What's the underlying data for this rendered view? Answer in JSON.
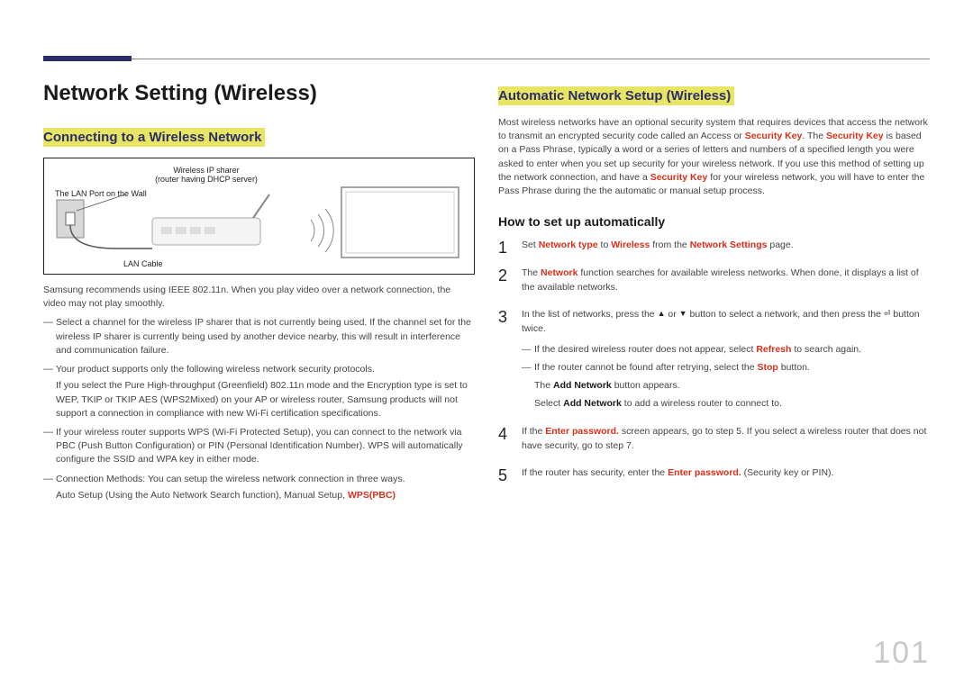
{
  "page_number": "101",
  "left": {
    "title": "Network Setting (Wireless)",
    "section1_head": "Connecting to a Wireless Network",
    "diagram": {
      "ip_sharer_l1": "Wireless IP sharer",
      "ip_sharer_l2": "(router having DHCP server)",
      "lan_port": "The LAN Port on the Wall",
      "lan_cable": "LAN Cable"
    },
    "intro": "Samsung recommends using IEEE 802.11n. When you play video over a network connection, the video may not play smoothly.",
    "bullets": [
      {
        "main": "Select a channel for the wireless IP sharer that is not currently being used. If the channel set for the wireless IP sharer is currently being used by another device nearby, this will result in interference and communication failure."
      },
      {
        "main": "Your product supports only the following wireless network security protocols.",
        "sub": "If you select the Pure High-throughput (Greenfield) 802.11n mode and the Encryption type is set to WEP, TKIP or TKIP AES (WPS2Mixed) on your AP or wireless router, Samsung products will not support a connection in compliance with new Wi-Fi certification specifications."
      },
      {
        "main": "If your wireless router supports WPS (Wi-Fi Protected Setup), you can connect to the network via PBC (Push Button Configuration) or PIN (Personal Identification Number). WPS will automatically configure the SSID and WPA key in either mode."
      },
      {
        "main": "Connection Methods: You can setup the wireless network connection in three ways.",
        "sub_pre": "Auto Setup (Using the Auto Network Search function), Manual Setup, ",
        "sub_hl": "WPS(PBC)"
      }
    ]
  },
  "right": {
    "section2_head": "Automatic Network Setup (Wireless)",
    "para_parts": {
      "p1": "Most wireless networks have an optional security system that requires devices that access the network to transmit an encrypted security code called an Access or ",
      "sk1": "Security Key",
      "p2": ". The ",
      "sk2": "Security Key",
      "p3": " is based on a Pass Phrase, typically a word or a series of letters and numbers of a specified length you were asked to enter when you set up security for your wireless network. If you use this method of setting up the network connection, and have a ",
      "sk3": "Security Key",
      "p4": " for your wireless network, you will have to enter the Pass Phrase during the the automatic or manual setup process."
    },
    "subhead": "How to set up automatically",
    "steps": {
      "s1_pre": "Set ",
      "s1_nt": "Network type",
      "s1_mid": " to ",
      "s1_w": "Wireless",
      "s1_mid2": " from the ",
      "s1_ns": "Network Settings",
      "s1_post": " page.",
      "s2_pre": "The ",
      "s2_net": "Network",
      "s2_post": " function searches for available wireless networks. When done, it displays a list of the available networks.",
      "s3_pre": "In the list of networks, press the ",
      "s3_mid": " or ",
      "s3_mid2": " button to select a network, and then press the ",
      "s3_post": " button twice.",
      "s3b1_pre": "If the desired wireless router does not appear, select ",
      "s3b1_ref": "Refresh",
      "s3b1_post": " to search again.",
      "s3b2_pre": "If the router cannot be found after retrying, select the ",
      "s3b2_stop": "Stop",
      "s3b2_post": " button.",
      "s3p1_pre": "The ",
      "s3p1_an": "Add Network",
      "s3p1_post": " button appears.",
      "s3p2_pre": "Select ",
      "s3p2_an": "Add Network",
      "s3p2_post": " to add a wireless router to connect to.",
      "s4_pre": "If the ",
      "s4_ep": "Enter password.",
      "s4_post": " screen appears, go to step 5. If you select a wireless router that does not have security, go to step 7.",
      "s5_pre": "If the router has security, enter the ",
      "s5_ep": "Enter password.",
      "s5_post": " (Security key or PIN)."
    }
  }
}
